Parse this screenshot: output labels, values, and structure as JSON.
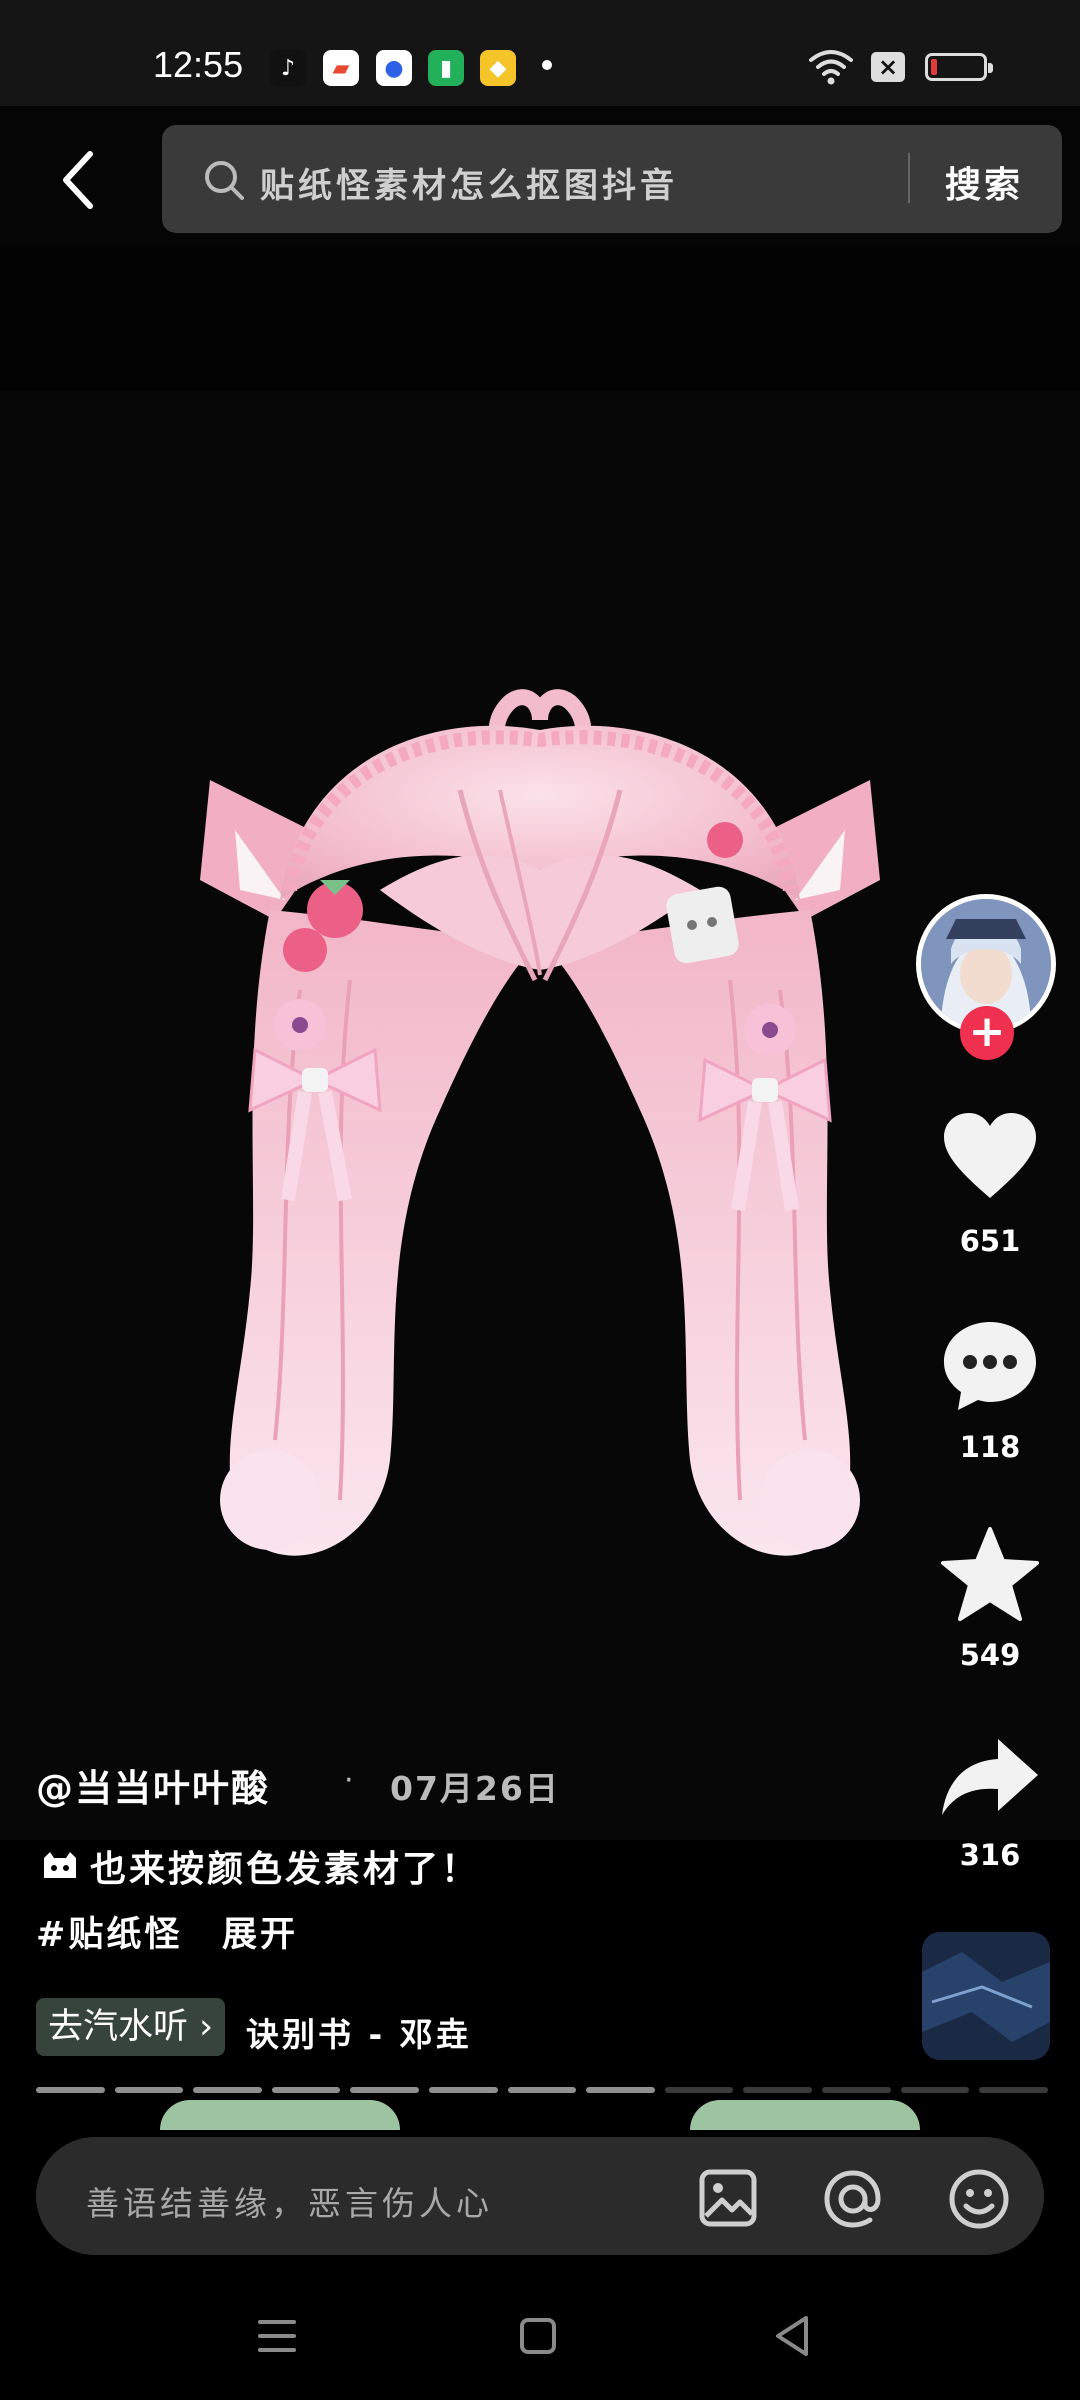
{
  "status_bar": {
    "time": "12:55",
    "app_icons": [
      "tiktok-icon",
      "gallery-icon",
      "baidu-icon",
      "battery-app-icon",
      "gold-app-icon"
    ]
  },
  "search": {
    "query": "贴纸怪素材怎么抠图抖音",
    "button_label": "搜索"
  },
  "post": {
    "author": "@当当叶叶酸",
    "separator": "·",
    "date": "07月26日",
    "description": "也来按颜色发素材了！",
    "hashtag": "#贴纸怪",
    "expand_label": "展开",
    "music_chip": "去汽水听",
    "music_title": "诀别书 - 邓垚"
  },
  "actions": {
    "likes": "651",
    "comments": "118",
    "favorites": "549",
    "shares": "316",
    "follow_symbol": "+"
  },
  "progress": {
    "segments": 13,
    "completed": 8
  },
  "comment_bar": {
    "placeholder": "善语结善缘，恶言伤人心"
  },
  "colors": {
    "accent_red": "#f0304f",
    "hair_pink": "#f6c5d3",
    "music_chip_bg": "#36443c"
  }
}
